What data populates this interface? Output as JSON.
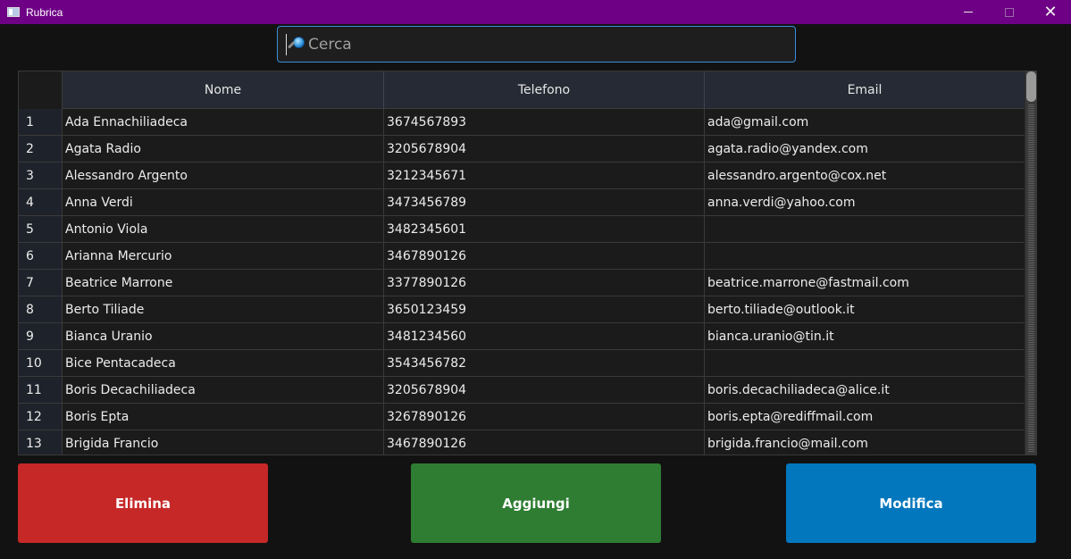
{
  "window": {
    "title": "Rubrica"
  },
  "search": {
    "placeholder": "Cerca"
  },
  "table": {
    "headers": [
      "Nome",
      "Telefono",
      "Email"
    ],
    "rows": [
      {
        "n": "1",
        "nome": "Ada Ennachiliadeca",
        "telefono": "3674567893",
        "email": "ada@gmail.com"
      },
      {
        "n": "2",
        "nome": "Agata Radio",
        "telefono": "3205678904",
        "email": "agata.radio@yandex.com"
      },
      {
        "n": "3",
        "nome": "Alessandro Argento",
        "telefono": "3212345671",
        "email": "alessandro.argento@cox.net"
      },
      {
        "n": "4",
        "nome": "Anna Verdi",
        "telefono": "3473456789",
        "email": "anna.verdi@yahoo.com"
      },
      {
        "n": "5",
        "nome": "Antonio Viola",
        "telefono": "3482345601",
        "email": ""
      },
      {
        "n": "6",
        "nome": "Arianna Mercurio",
        "telefono": "3467890126",
        "email": ""
      },
      {
        "n": "7",
        "nome": "Beatrice Marrone",
        "telefono": "3377890126",
        "email": "beatrice.marrone@fastmail.com"
      },
      {
        "n": "8",
        "nome": "Berto Tiliade",
        "telefono": "3650123459",
        "email": "berto.tiliade@outlook.it"
      },
      {
        "n": "9",
        "nome": "Bianca Uranio",
        "telefono": "3481234560",
        "email": "bianca.uranio@tin.it"
      },
      {
        "n": "10",
        "nome": "Bice Pentacadeca",
        "telefono": "3543456782",
        "email": ""
      },
      {
        "n": "11",
        "nome": "Boris Decachiliadeca",
        "telefono": "3205678904",
        "email": "boris.decachiliadeca@alice.it"
      },
      {
        "n": "12",
        "nome": "Boris Epta",
        "telefono": "3267890126",
        "email": "boris.epta@rediffmail.com"
      },
      {
        "n": "13",
        "nome": "Brigida Francio",
        "telefono": "3467890126",
        "email": "brigida.francio@mail.com"
      }
    ]
  },
  "buttons": {
    "delete": {
      "label": "Elimina",
      "color": "#c62828"
    },
    "add": {
      "label": "Aggiungi",
      "color": "#2e7d32"
    },
    "edit": {
      "label": "Modifica",
      "color": "#0277bd"
    }
  },
  "colors": {
    "titlebar": "#6e0085",
    "search_border": "#3b8fdc"
  },
  "icons": {
    "app": "window-icon",
    "search": "magnifier-icon",
    "minimize": "minimize-icon",
    "maximize": "maximize-icon",
    "close": "close-icon"
  }
}
